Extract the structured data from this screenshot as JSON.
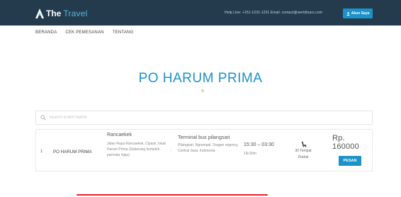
{
  "header": {
    "brand_the": "The",
    "brand_travel": "Travel",
    "contact": "Help Line: +151-1231-1231   Email: contact@worldtours.com",
    "account_label": "Akun Saya"
  },
  "nav": {
    "items": [
      "BERANDA",
      "CEK PEMESANAN",
      "TENTANG"
    ]
  },
  "page": {
    "title": "PO HARUM PRIMA"
  },
  "search": {
    "placeholder": "Search Event Name"
  },
  "results": [
    {
      "index": "1",
      "name": "PO HARUM PRIMA",
      "origin_title": "Rancaekek",
      "origin_address": "Jalan Raya Rancaekek, Cipasir, lokat Harum Prima (Seberang komplek parmata hijau)",
      "arrow": "→",
      "destination_title": "Terminal bus pilangsari",
      "destination_address": "Pilangsari, Ngrampal, Sragen regency, Central Java, Indonesia",
      "time_range": "15:30 – 03:30",
      "duration": "14j 00m",
      "seats": "30 Tempat Duduk",
      "price": "Rp. 160000",
      "book_label": "PESAN"
    }
  ],
  "colors": {
    "topbar": "#233b4c",
    "accent": "#1b92c8",
    "brand_travel": "#52b8e6",
    "bottom_line": "#e3212b"
  },
  "icons": [
    "brand-logo-icon",
    "person-icon",
    "search-icon",
    "seat-icon"
  ]
}
